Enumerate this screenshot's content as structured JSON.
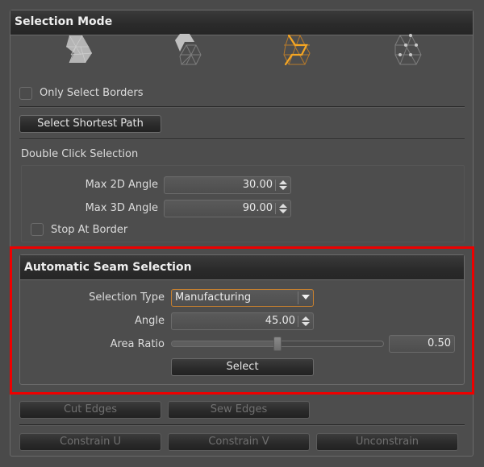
{
  "selection_mode": {
    "title": "Selection Mode",
    "modes": [
      {
        "name": "face-mode",
        "icon": "faces-icon",
        "active": false
      },
      {
        "name": "island-mode",
        "icon": "island-icon",
        "active": false
      },
      {
        "name": "edge-mode",
        "icon": "edges-icon",
        "active": true
      },
      {
        "name": "vertex-mode",
        "icon": "vertices-icon",
        "active": false
      }
    ],
    "only_select_borders": {
      "label": "Only Select Borders",
      "checked": false
    },
    "select_shortest_path_label": "Select Shortest Path",
    "double_click": {
      "title": "Double Click Selection",
      "max_2d_angle": {
        "label": "Max 2D Angle",
        "value": "30.00"
      },
      "max_3d_angle": {
        "label": "Max 3D Angle",
        "value": "90.00"
      },
      "stop_at_border": {
        "label": "Stop At Border",
        "checked": false
      }
    }
  },
  "auto_seam": {
    "title": "Automatic Seam Selection",
    "selection_type": {
      "label": "Selection Type",
      "value": "Manufacturing"
    },
    "angle": {
      "label": "Angle",
      "value": "45.00"
    },
    "area_ratio": {
      "label": "Area Ratio",
      "value": "0.50",
      "fraction": 0.5
    },
    "select_label": "Select"
  },
  "actions": {
    "cut_edges": "Cut Edges",
    "sew_edges": "Sew Edges",
    "constrain_u": "Constrain U",
    "constrain_v": "Constrain V",
    "unconstrain": "Unconstrain"
  },
  "colors": {
    "accent": "#f5a623",
    "highlight": "#ee0000",
    "dropdown_border": "#c8802e"
  }
}
